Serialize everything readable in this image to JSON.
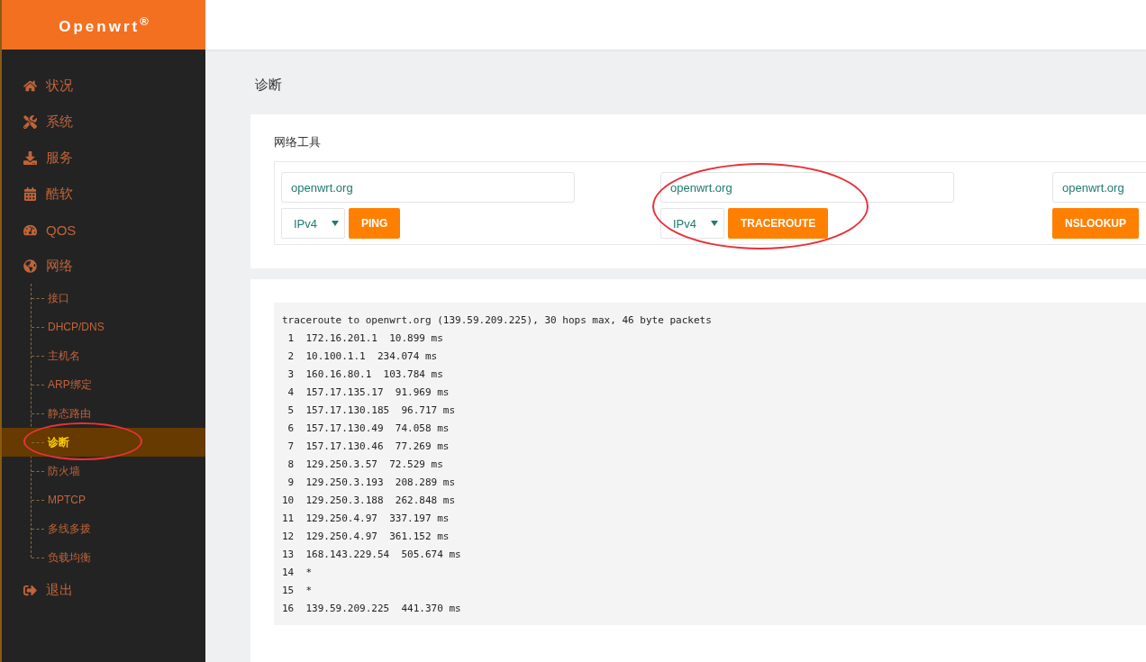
{
  "brand": {
    "name": "Openwrt$^{®}$"
  },
  "sidebar": {
    "items": [
      {
        "label": "状况",
        "selected": false,
        "circled": false
      },
      {
        "label": "系统",
        "selected": false,
        "circled": false
      },
      {
        "label": "服务",
        "selected": false,
        "circled": false
      },
      {
        "label": "酷软",
        "selected": false,
        "circled": false
      },
      {
        "label": "QOS",
        "selected": false,
        "circled": false
      },
      {
        "label": "网络",
        "selected": false,
        "circled": false,
        "expanded": true,
        "children": [
          {
            "label": "接口",
            "selected": false,
            "circled": false
          },
          {
            "label": "DHCP/DNS",
            "selected": false,
            "circled": false
          },
          {
            "label": "主机名",
            "selected": false,
            "circled": false
          },
          {
            "label": "ARP绑定",
            "selected": false,
            "circled": false
          },
          {
            "label": "静态路由",
            "selected": false,
            "circled": false
          },
          {
            "label": "诊断",
            "selected": true,
            "circled": true
          },
          {
            "label": "防火墙",
            "selected": false,
            "circled": false
          },
          {
            "label": "MPTCP",
            "selected": false,
            "circled": false
          },
          {
            "label": "多线多拨",
            "selected": false,
            "circled": false
          },
          {
            "label": "负载均衡",
            "selected": false,
            "circled": false
          }
        ]
      },
      {
        "label": "退出",
        "selected": false,
        "circled": false
      }
    ]
  },
  "page": {
    "title": "诊断"
  },
  "tools": {
    "title": "网络工具",
    "items": [
      {
        "host": "openwrt.org",
        "protocol": "IPv4",
        "button": "PING",
        "circled": false
      },
      {
        "host": "openwrt.org",
        "protocol": "IPv4",
        "button": "TRACEROUTE",
        "circled": true
      },
      {
        "host": "openwrt.org",
        "button": "NSLOOKUP",
        "circled": false
      }
    ]
  },
  "output": {
    "lines": [
      "traceroute to openwrt.org (139.59.209.225), 30 hops max, 46 byte packets",
      " 1  172.16.201.1  10.899 ms",
      " 2  10.100.1.1  234.074 ms",
      " 3  160.16.80.1  103.784 ms",
      " 4  157.17.135.17  91.969 ms",
      " 5  157.17.130.185  96.717 ms",
      " 6  157.17.130.49  74.058 ms",
      " 7  157.17.130.46  77.269 ms",
      " 8  129.250.3.57  72.529 ms",
      " 9  129.250.3.193  208.289 ms",
      "10  129.250.3.188  262.848 ms",
      "11  129.250.4.97  337.197 ms",
      "12  129.250.4.97  361.152 ms",
      "13  168.143.229.54  505.674 ms",
      "14  *",
      "15  *",
      "16  139.59.209.225  441.370 ms"
    ]
  }
}
